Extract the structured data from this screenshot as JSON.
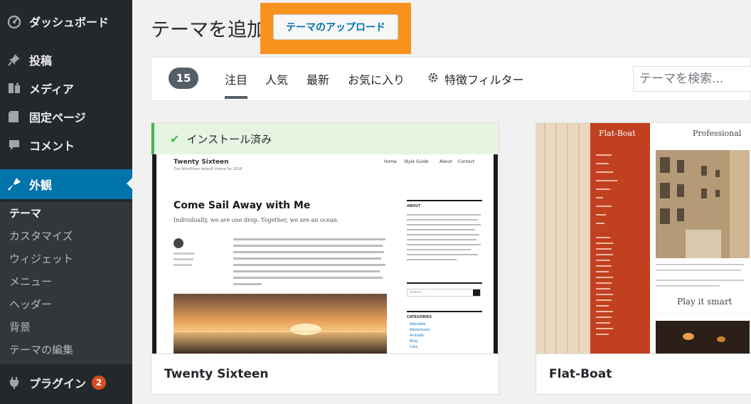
{
  "sidebar": {
    "top_items": [
      {
        "label": "ダッシュボード",
        "icon": "dashboard-icon"
      },
      {
        "label": "投稿",
        "icon": "pin-icon"
      },
      {
        "label": "メディア",
        "icon": "media-icon"
      },
      {
        "label": "固定ページ",
        "icon": "page-icon"
      },
      {
        "label": "コメント",
        "icon": "comment-icon"
      }
    ],
    "current_item": {
      "label": "外観",
      "icon": "appearance-icon"
    },
    "submenu": [
      "テーマ",
      "カスタマイズ",
      "ウィジェット",
      "メニュー",
      "ヘッダー",
      "背景",
      "テーマの編集"
    ],
    "plugins": {
      "label": "プラグイン",
      "badge": "2",
      "icon": "plugin-icon"
    }
  },
  "header": {
    "title": "テーマを追加",
    "upload_button": "テーマのアップロード"
  },
  "filter_bar": {
    "count": "15",
    "tabs": [
      "注目",
      "人気",
      "最新",
      "お気に入り"
    ],
    "feature_filter": "特徴フィルター",
    "search_placeholder": "テーマを検索..."
  },
  "themes": [
    {
      "name": "Twenty Sixteen",
      "installed_notice": "インストール済み",
      "preview": {
        "site_title": "Twenty Sixteen",
        "tagline": "The WordPress default theme for 2016",
        "nav": [
          "Home",
          "Style Guide",
          "About",
          "Contact"
        ],
        "post_title": "Come Sail Away with Me",
        "post_excerpt": "Individually, we are one drop. Together, we are an ocean.",
        "widget_about": "ABOUT",
        "widget_search": "Search ...",
        "widget_categories": "CATEGORIES",
        "categories": [
          "Adorable",
          "Adventures",
          "Animals",
          "Blog",
          "Cats"
        ]
      }
    },
    {
      "name": "Flat-Boat",
      "preview": {
        "logo": "Flat-Boat",
        "heading": "Professional",
        "post_title": "Play it smart"
      }
    }
  ],
  "colors": {
    "sidebar_bg": "#23282d",
    "accent": "#0073aa",
    "highlight": "#f7931e",
    "badge": "#d54e21",
    "installed": "#46b450"
  }
}
